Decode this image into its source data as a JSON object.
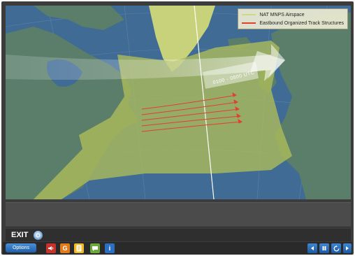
{
  "legend": {
    "items": [
      {
        "label": "NAT MNPS Airspace",
        "color": "#c9d98a"
      },
      {
        "label": "Eastbound Organized Track Structures",
        "color": "#e0402e"
      }
    ]
  },
  "map": {
    "band_label": "0100 - 0800 UTC",
    "colors": {
      "ocean": "#3f6b95",
      "land": "#5a7e6a",
      "airspace": "#a9b95a",
      "tracks": "#e0402e",
      "greenland": "#c7d27a"
    }
  },
  "caption": {
    "text": ""
  },
  "exit_bar": {
    "exit_label": "EXIT",
    "info_text": "",
    "page_text": ""
  },
  "toolbar": {
    "options_label": "Options",
    "tools": [
      {
        "name": "audio-icon",
        "color": "#c8322b",
        "glyph": ""
      },
      {
        "name": "glossary-icon",
        "color": "#e07a1a",
        "glyph": "G"
      },
      {
        "name": "notes-icon",
        "color": "#f0b92a",
        "glyph": ""
      },
      {
        "name": "comments-icon",
        "color": "#6aa83a",
        "glyph": ""
      },
      {
        "name": "info-icon",
        "color": "#2c6fc0",
        "glyph": "i"
      }
    ]
  }
}
